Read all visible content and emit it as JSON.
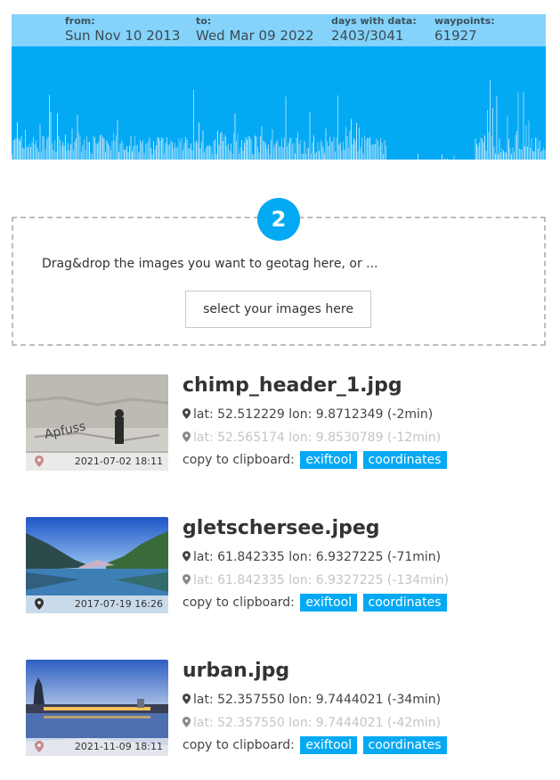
{
  "stats": {
    "from_label": "from:",
    "from_value": "Sun Nov 10 2013",
    "to_label": "to:",
    "to_value": "Wed Mar 09 2022",
    "days_label": "days with data:",
    "days_value": "2403/3041",
    "waypoints_label": "waypoints:",
    "waypoints_value": "61927"
  },
  "colors": {
    "accent": "#04a9f4",
    "header_bar": "#85d3fa",
    "histogram_bars": "#bfe7fb"
  },
  "dropzone": {
    "step_number": "2",
    "text": "Drag&drop the images you want to geotag here, or ...",
    "button_label": "select your images here"
  },
  "images": [
    {
      "filename": "chimp_header_1.jpg",
      "date": "2021-07-02 18:11",
      "primary_coord": "lat: 52.512229 lon: 9.8712349 (-2min)",
      "secondary_coord": "lat: 52.565174 lon: 9.8530789 (-12min)",
      "copy_label": "copy to clipboard:",
      "exiftool_label": "exiftool",
      "coordinates_label": "coordinates",
      "thumb_icon": "map-pin-icon"
    },
    {
      "filename": "gletschersee.jpeg",
      "date": "2017-07-19 16:26",
      "primary_coord": "lat: 61.842335 lon: 6.9327225 (-71min)",
      "secondary_coord": "lat: 61.842335 lon: 6.9327225 (-134min)",
      "copy_label": "copy to clipboard:",
      "exiftool_label": "exiftool",
      "coordinates_label": "coordinates",
      "thumb_icon": "map-pin-icon"
    },
    {
      "filename": "urban.jpg",
      "date": "2021-11-09 18:11",
      "primary_coord": "lat: 52.357550 lon: 9.7444021 (-34min)",
      "secondary_coord": "lat: 52.357550 lon: 9.7444021 (-42min)",
      "copy_label": "copy to clipboard:",
      "exiftool_label": "exiftool",
      "coordinates_label": "coordinates",
      "thumb_icon": "map-pin-icon"
    }
  ]
}
